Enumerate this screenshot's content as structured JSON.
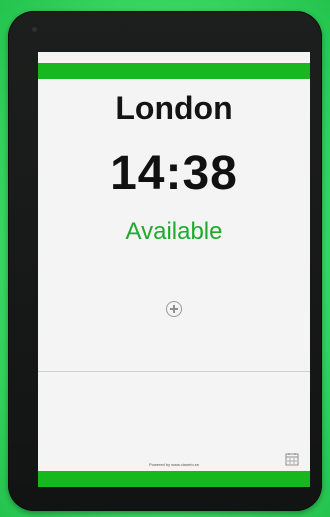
{
  "room": {
    "city": "London",
    "time": "14:38",
    "status": "Available"
  },
  "footer": {
    "powered_by": "Powered by www.vianeto.se"
  },
  "icons": {
    "add": "add-circle-icon",
    "calendar": "calendar-icon"
  },
  "colors": {
    "accent_green": "#16b81e",
    "status_green": "#1faa2e",
    "bezel": "#171818",
    "screen_bg": "#f4f4f4"
  }
}
